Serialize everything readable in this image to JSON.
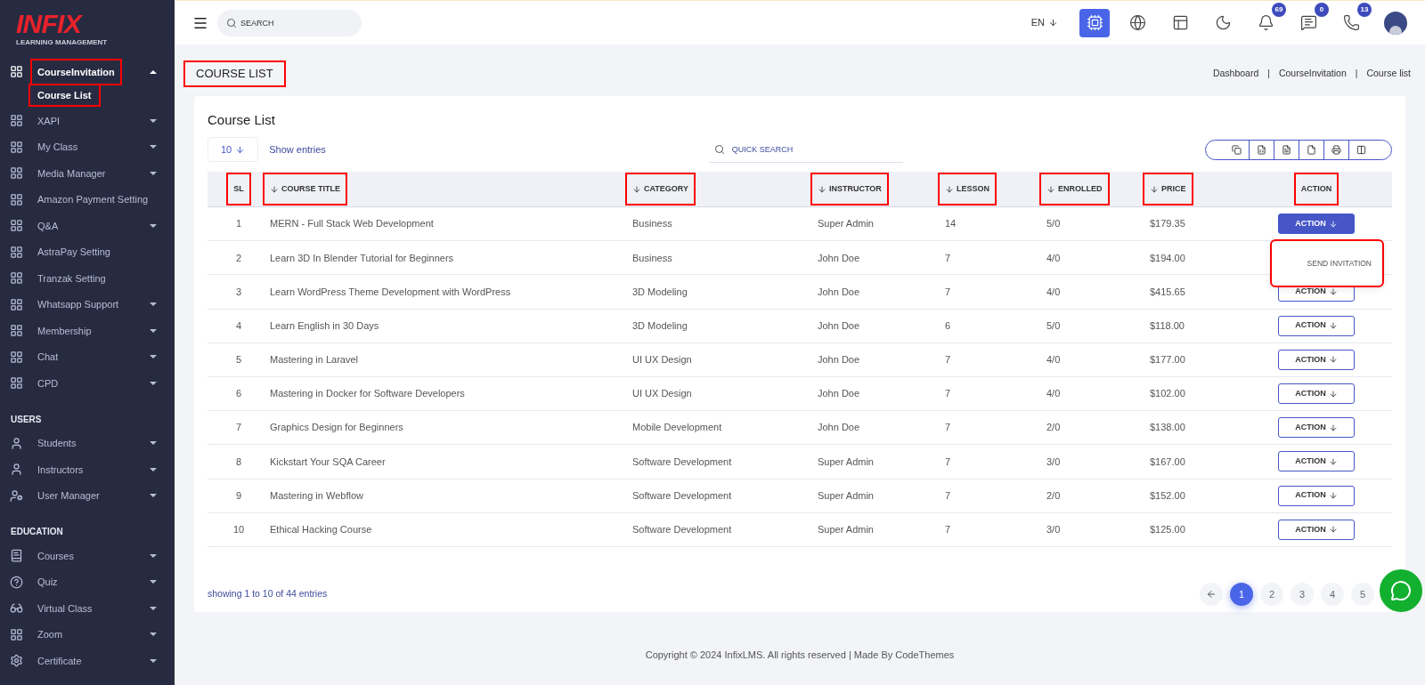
{
  "sidebar": {
    "logo": {
      "name": "INFIX",
      "tagline": "LEARNING MANAGEMENT"
    },
    "sections": [
      {
        "items": [
          {
            "label": "CourseInvitation",
            "kind": "grid",
            "expandable": true,
            "expanded": true,
            "highlighted": true,
            "children": [
              {
                "label": "Course List",
                "selected": true,
                "highlighted": true
              }
            ]
          },
          {
            "label": "XAPI",
            "kind": "grid",
            "expandable": true,
            "expanded": false,
            "highlighted": false
          },
          {
            "label": "My Class",
            "kind": "grid",
            "expandable": true,
            "expanded": false,
            "highlighted": false
          },
          {
            "label": "Media Manager",
            "kind": "grid",
            "expandable": true,
            "expanded": false,
            "highlighted": false
          },
          {
            "label": "Amazon Payment Setting",
            "kind": "grid",
            "expandable": false,
            "highlighted": false
          },
          {
            "label": "Q&A",
            "kind": "grid",
            "expandable": true,
            "expanded": false,
            "highlighted": false
          },
          {
            "label": "AstraPay Setting",
            "kind": "grid",
            "expandable": false,
            "highlighted": false
          },
          {
            "label": "Tranzak Setting",
            "kind": "grid",
            "expandable": false,
            "highlighted": false
          },
          {
            "label": "Whatsapp Support",
            "kind": "grid",
            "expandable": true,
            "expanded": false,
            "highlighted": false
          },
          {
            "label": "Membership",
            "kind": "grid",
            "expandable": true,
            "expanded": false,
            "highlighted": false
          },
          {
            "label": "Chat",
            "kind": "grid",
            "expandable": true,
            "expanded": false,
            "highlighted": false
          },
          {
            "label": "CPD",
            "kind": "grid",
            "expandable": true,
            "expanded": false,
            "highlighted": false
          }
        ]
      },
      {
        "heading": "USERS",
        "items": [
          {
            "label": "Students",
            "kind": "user",
            "expandable": true,
            "expanded": false,
            "highlighted": false
          },
          {
            "label": "Instructors",
            "kind": "tie",
            "expandable": true,
            "expanded": false,
            "highlighted": false
          },
          {
            "label": "User Manager",
            "kind": "usergear",
            "expandable": true,
            "expanded": false,
            "highlighted": false
          }
        ]
      },
      {
        "heading": "EDUCATION",
        "items": [
          {
            "label": "Courses",
            "kind": "book",
            "expandable": true,
            "expanded": false,
            "highlighted": false
          },
          {
            "label": "Quiz",
            "kind": "question",
            "expandable": true,
            "expanded": false,
            "highlighted": false
          },
          {
            "label": "Virtual Class",
            "kind": "vr",
            "expandable": true,
            "expanded": false,
            "highlighted": false
          },
          {
            "label": "Zoom",
            "kind": "grid",
            "expandable": true,
            "expanded": false,
            "highlighted": false
          },
          {
            "label": "Certificate",
            "kind": "gear",
            "expandable": true,
            "expanded": false,
            "highlighted": false
          }
        ]
      }
    ]
  },
  "topbar": {
    "search": {
      "placeholder": "SEARCH"
    },
    "language": "EN",
    "icons": [
      {
        "kind": "ai",
        "selected": true
      },
      {
        "kind": "globe",
        "selected": false
      },
      {
        "kind": "layout",
        "selected": false
      },
      {
        "kind": "moon",
        "selected": false
      },
      {
        "kind": "bell",
        "badge": "69",
        "selected": false
      },
      {
        "kind": "message",
        "badge": "0",
        "selected": false
      },
      {
        "kind": "whatsapp",
        "badge": "13",
        "selected": false
      }
    ]
  },
  "page": {
    "title": "COURSE LIST",
    "title_highlighted": true,
    "breadcrumb": [
      "Dashboard",
      "CourseInvitation",
      "Course list"
    ],
    "breadcrumb_separator": "|"
  },
  "card": {
    "title": "Course List",
    "page_size": "10",
    "show_entries": "Show entries",
    "quick_search": {
      "placeholder": "QUICK SEARCH"
    },
    "export_buttons": [
      {
        "kind": "copy"
      },
      {
        "kind": "excel"
      },
      {
        "kind": "csv"
      },
      {
        "kind": "pdf"
      },
      {
        "kind": "print"
      },
      {
        "kind": "columns"
      }
    ],
    "columns": [
      {
        "label": "SL",
        "sortable": false,
        "highlighted": true
      },
      {
        "label": "COURSE TITLE",
        "sortable": true,
        "highlighted": true
      },
      {
        "label": "CATEGORY",
        "sortable": true,
        "highlighted": true
      },
      {
        "label": "INSTRUCTOR",
        "sortable": true,
        "highlighted": true
      },
      {
        "label": "LESSON",
        "sortable": true,
        "highlighted": true
      },
      {
        "label": "ENROLLED",
        "sortable": true,
        "highlighted": true
      },
      {
        "label": "PRICE",
        "sortable": true,
        "highlighted": true
      },
      {
        "label": "ACTION",
        "sortable": false,
        "highlighted": true
      }
    ],
    "rows": [
      {
        "sl": "1",
        "title": "MERN - Full Stack Web Development",
        "category": "Business",
        "instructor": "Super Admin",
        "lesson": "14",
        "enrolled": "5/0",
        "price": "$179.35",
        "action": "ACTION",
        "selected": true,
        "menu_highlighted": true,
        "menu": [
          "SEND INVITATION"
        ]
      },
      {
        "sl": "2",
        "title": "Learn 3D In Blender Tutorial for Beginners",
        "category": "Business",
        "instructor": "John Doe",
        "lesson": "7",
        "enrolled": "4/0",
        "price": "$194.00"
      },
      {
        "sl": "3",
        "title": "Learn WordPress Theme Development with WordPress",
        "category": "3D Modeling",
        "instructor": "John Doe",
        "lesson": "7",
        "enrolled": "4/0",
        "price": "$415.65",
        "action": "ACTION",
        "selected": false
      },
      {
        "sl": "4",
        "title": "Learn English in 30 Days",
        "category": "3D Modeling",
        "instructor": "John Doe",
        "lesson": "6",
        "enrolled": "5/0",
        "price": "$118.00",
        "action": "ACTION",
        "selected": false
      },
      {
        "sl": "5",
        "title": "Mastering in Laravel",
        "category": "UI UX Design",
        "instructor": "John Doe",
        "lesson": "7",
        "enrolled": "4/0",
        "price": "$177.00",
        "action": "ACTION",
        "selected": false
      },
      {
        "sl": "6",
        "title": "Mastering in Docker for Software Developers",
        "category": "UI UX Design",
        "instructor": "John Doe",
        "lesson": "7",
        "enrolled": "4/0",
        "price": "$102.00",
        "action": "ACTION",
        "selected": false
      },
      {
        "sl": "7",
        "title": "Graphics Design for Beginners",
        "category": "Mobile Development",
        "instructor": "John Doe",
        "lesson": "7",
        "enrolled": "2/0",
        "price": "$138.00",
        "action": "ACTION",
        "selected": false
      },
      {
        "sl": "8",
        "title": "Kickstart Your SQA Career",
        "category": "Software Development",
        "instructor": "Super Admin",
        "lesson": "7",
        "enrolled": "3/0",
        "price": "$167.00",
        "action": "ACTION",
        "selected": false
      },
      {
        "sl": "9",
        "title": "Mastering in Webflow",
        "category": "Software Development",
        "instructor": "Super Admin",
        "lesson": "7",
        "enrolled": "2/0",
        "price": "$152.00",
        "action": "ACTION",
        "selected": false
      },
      {
        "sl": "10",
        "title": "Ethical Hacking Course",
        "category": "Software Development",
        "instructor": "Super Admin",
        "lesson": "7",
        "enrolled": "3/0",
        "price": "$125.00",
        "action": "ACTION",
        "selected": false
      }
    ],
    "summary": "showing 1 to 10 of 44 entries",
    "pages": [
      {
        "label": "1",
        "selected": true
      },
      {
        "label": "2",
        "selected": false
      },
      {
        "label": "3",
        "selected": false
      },
      {
        "label": "4",
        "selected": false
      },
      {
        "label": "5",
        "selected": false
      }
    ]
  },
  "footer": "Copyright © 2024 InfixLMS. All rights reserved | Made By CodeThemes"
}
